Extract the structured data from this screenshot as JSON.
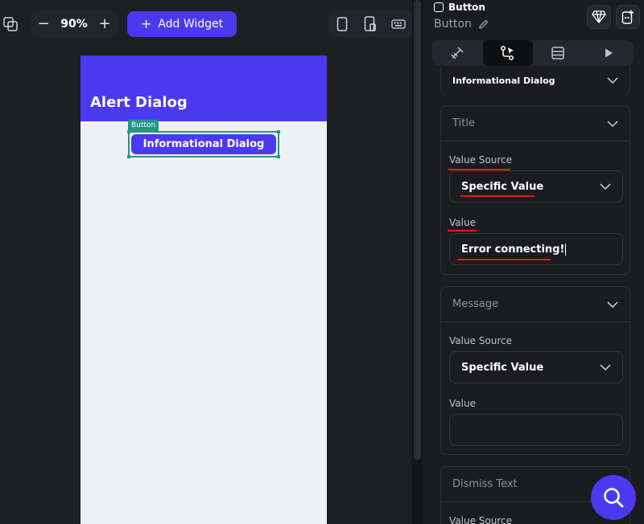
{
  "canvas": {
    "zoom": {
      "minus_label": "−",
      "value": "90%",
      "plus_label": "+"
    },
    "add_widget": {
      "icon": "plus-icon",
      "label": "Add Widget"
    },
    "devices": [
      "phone-icon",
      "tablet-icon",
      "keyboard-icon"
    ],
    "phone": {
      "title": "Alert Dialog",
      "selected_tag": "Button",
      "selected_button_label": "Informational Dialog"
    }
  },
  "panel": {
    "widget_type": "Button",
    "widget_name": "Button",
    "top_buttons": [
      "diamond-icon",
      "add-page-icon"
    ],
    "tabs": [
      {
        "icon": "paint-icon",
        "active": false
      },
      {
        "icon": "actions-icon",
        "active": true
      },
      {
        "icon": "backend-icon",
        "active": false
      },
      {
        "icon": "play-icon",
        "active": false
      }
    ],
    "dialog_type": {
      "value": "Informational Dialog"
    },
    "title_section": {
      "header": "Title",
      "value_source_label": "Value Source",
      "value_source": "Specific Value",
      "value_label": "Value",
      "value": "Error connecting!"
    },
    "message_section": {
      "header": "Message",
      "value_source_label": "Value Source",
      "value_source": "Specific Value",
      "value_label": "Value",
      "value": ""
    },
    "dismiss_section": {
      "header": "Dismiss Text",
      "value_source_label": "Value Source"
    }
  },
  "colors": {
    "primary": "#4b39ef",
    "selection": "#249689",
    "annotation": "#e8191d",
    "panel_bg": "#1a1c20"
  }
}
